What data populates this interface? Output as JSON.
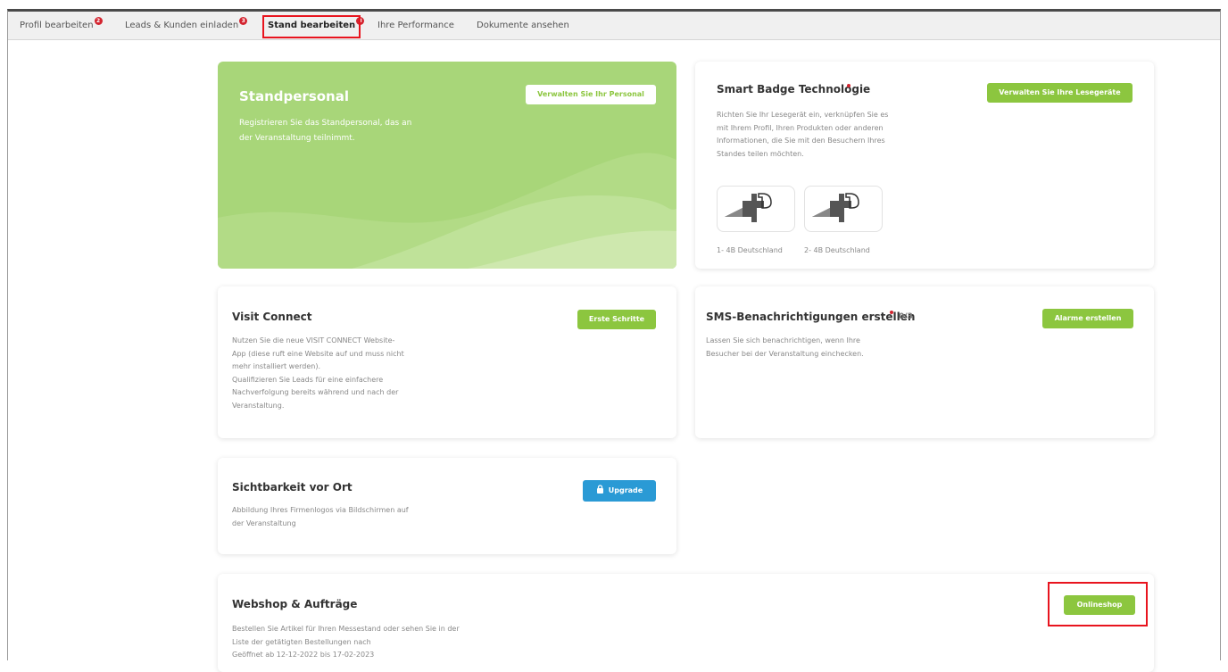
{
  "tabs": [
    {
      "label": "Profil bearbeiten",
      "badge": "2"
    },
    {
      "label": "Leads & Kunden einladen",
      "badge": "3"
    },
    {
      "label": "Stand bearbeiten",
      "badge": "3"
    },
    {
      "label": "Ihre Performance"
    },
    {
      "label": "Dokumente ansehen"
    }
  ],
  "cards": {
    "standpersonal": {
      "title": "Standpersonal",
      "text_line1": "Registrieren Sie das Standpersonal, das an",
      "text_line2": "der Veranstaltung teilnimmt.",
      "button": "Verwalten Sie Ihr Personal"
    },
    "smart_badge": {
      "title": "Smart Badge Technologie",
      "text": [
        "Richten Sie Ihr Lesegerät ein, verknüpfen Sie es",
        "mit Ihrem Profil, Ihren Produkten oder anderen",
        "Informationen, die Sie mit den Besuchern Ihres",
        "Standes teilen möchten."
      ],
      "button": "Verwalten Sie Ihre Lesegeräte",
      "devices": [
        {
          "label": "1- 4B Deutschland"
        },
        {
          "label": "2- 4B Deutschland"
        }
      ]
    },
    "visit_connect": {
      "title": "Visit Connect",
      "text": [
        "Nutzen Sie die neue VISIT CONNECT Website-",
        "App (diese ruft eine Website auf und muss nicht",
        "mehr installiert werden).",
        "Qualifizieren Sie Leads für eine einfachere",
        "Nachverfolgung bereits während und nach der",
        "Veranstaltung."
      ],
      "button": "Erste Schritte"
    },
    "sms": {
      "title": "SMS-Benachrichtigungen erstellen",
      "counter": "0/3",
      "text": [
        "Lassen Sie sich benachrichtigen, wenn Ihre",
        "Besucher bei der Veranstaltung einchecken."
      ],
      "button": "Alarme erstellen"
    },
    "sichtbarkeit": {
      "title": "Sichtbarkeit vor Ort",
      "text": [
        "Abbildung Ihres Firmenlogos via Bildschirmen auf",
        "der Veranstaltung"
      ],
      "button": "Upgrade",
      "button_icon": "lock-icon"
    },
    "webshop": {
      "title": "Webshop & Aufträge",
      "text": [
        "Bestellen Sie Artikel für Ihren Messestand oder sehen Sie in der",
        "Liste der getätigten Bestellungen nach",
        "Geöffnet ab 12-12-2022 bis 17-02-2023"
      ],
      "button": "Onlineshop"
    }
  },
  "colors": {
    "accent_green": "#8cc63f",
    "card_green": "#a8d679",
    "upgrade_blue": "#2a9ad5",
    "badge_red": "#d3242f",
    "highlight_red": "#e8141e"
  }
}
